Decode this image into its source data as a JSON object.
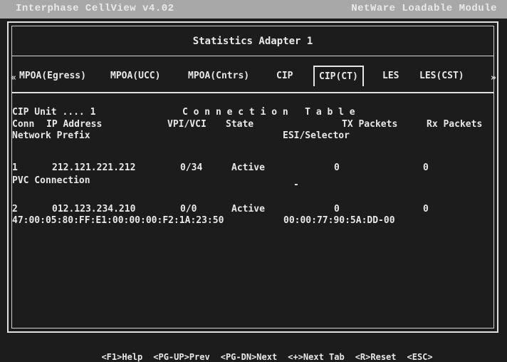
{
  "window": {
    "left_title": "Interphase CellView  v4.02",
    "right_title": "NetWare Loadable Module"
  },
  "adapter": {
    "title": "Statistics Adapter 1"
  },
  "tabs": {
    "left_arrow": "«",
    "right_arrow": "»",
    "items": [
      "MPOA(Egress)",
      "MPOA(UCC)",
      "MPOA(Cntrs)",
      "CIP",
      "CIP(CT)",
      "LES",
      "LES(CST)"
    ],
    "selected": "CIP(CT)"
  },
  "content": {
    "cip_unit": "CIP Unit .... 1",
    "table_title": "C o n n e c t i o n   T a b l e",
    "headers": {
      "conn": "Conn",
      "ip": "IP Address",
      "vpivci": "VPI/VCI",
      "state": "State",
      "tx": "TX Packets",
      "rx": "Rx Packets",
      "network_prefix": "Network Prefix",
      "esi_selector": "ESI/Selector"
    },
    "rows": [
      {
        "conn": "1",
        "ip": "212.121.221.212",
        "vpivci": "0/34",
        "state": "Active",
        "tx": "0",
        "rx": "0",
        "network_prefix": "PVC Connection",
        "esi_selector": "-"
      },
      {
        "conn": "2",
        "ip": "012.123.234.210",
        "vpivci": "0/0",
        "state": "Active",
        "tx": "0",
        "rx": "0",
        "network_prefix": "47:00:05:80:FF:E1:00:00:00:F2:1A:23:50",
        "esi_selector": "00:00:77:90:5A:DD-00"
      }
    ]
  },
  "footer_keys": [
    "<F1>Help",
    "<PG-UP>Prev",
    "<PG-DN>Next",
    "<+>Next Tab",
    "<R>Reset",
    "<ESC>"
  ]
}
